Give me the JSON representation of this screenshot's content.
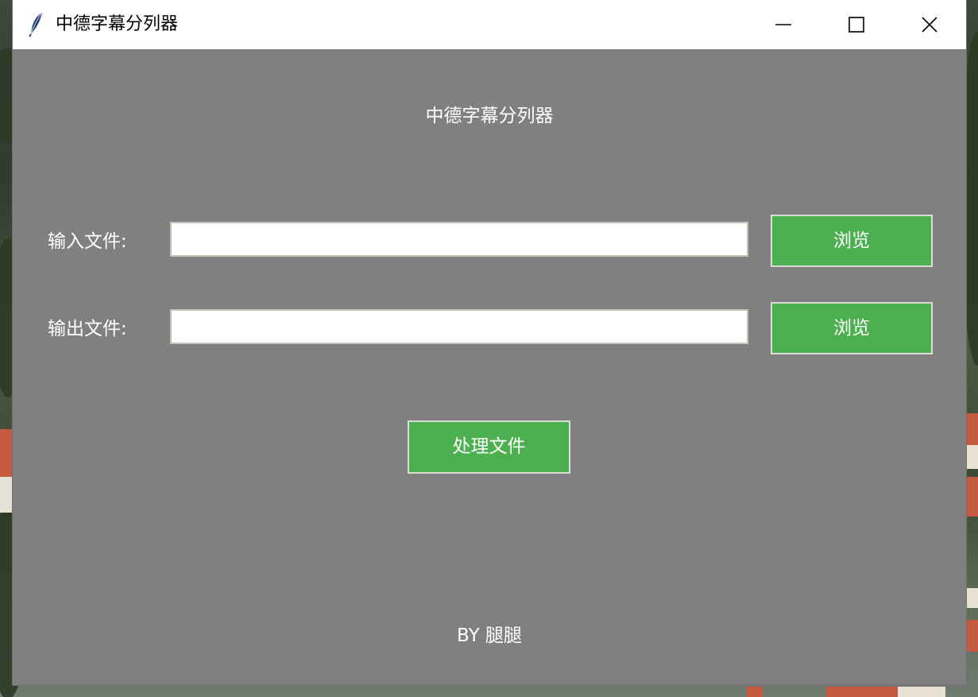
{
  "window": {
    "title": "中德字幕分列器",
    "icon": "feather-icon"
  },
  "controls": {
    "minimize_icon": "minimize-icon",
    "maximize_icon": "maximize-icon",
    "close_icon": "close-icon"
  },
  "main": {
    "heading": "中德字幕分列器",
    "input_row": {
      "label": "输入文件:",
      "value": "",
      "browse_label": "浏览"
    },
    "output_row": {
      "label": "输出文件:",
      "value": "",
      "browse_label": "浏览"
    },
    "process_label": "处理文件",
    "footer": "BY 腿腿"
  },
  "colors": {
    "background": "#808080",
    "button": "#4caf50",
    "text": "#ffffff"
  }
}
